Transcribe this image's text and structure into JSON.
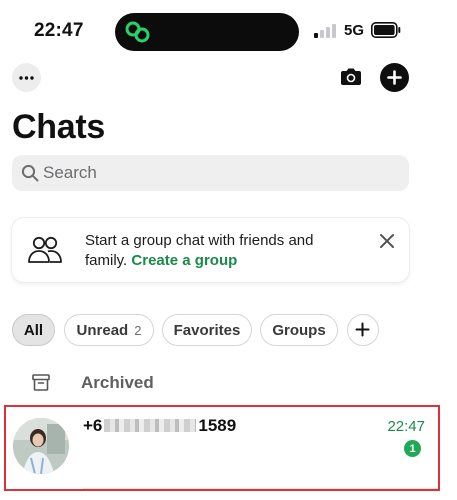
{
  "status_bar": {
    "time": "22:47",
    "network": "5G",
    "signal_bars_active": 1,
    "signal_bars_total": 4
  },
  "toolbar": {
    "more_icon": "ellipsis-icon",
    "camera_icon": "camera-icon",
    "new_chat_icon": "plus-icon"
  },
  "page_title": "Chats",
  "search": {
    "placeholder": "Search",
    "value": ""
  },
  "group_banner": {
    "text": "Start a group chat with friends and family.",
    "link_label": "Create a group",
    "icon": "people-icon",
    "close_icon": "close-icon"
  },
  "filters": {
    "chips": [
      {
        "label": "All",
        "count": "",
        "active": true
      },
      {
        "label": "Unread",
        "count": "2",
        "active": false
      },
      {
        "label": "Favorites",
        "count": "",
        "active": false
      },
      {
        "label": "Groups",
        "count": "",
        "active": false
      }
    ],
    "add_icon": "plus-icon"
  },
  "archived": {
    "label": "Archived",
    "icon": "archive-box-icon"
  },
  "chats": [
    {
      "name_prefix": "+6",
      "name_suffix": "1589",
      "name_redacted": true,
      "time": "22:47",
      "unread_count": "1"
    }
  ],
  "colors": {
    "accent_green": "#1a8a4a",
    "badge_green": "#1fa855",
    "highlight_red": "#e0303a",
    "chip_active_bg": "#e4e4e4"
  }
}
